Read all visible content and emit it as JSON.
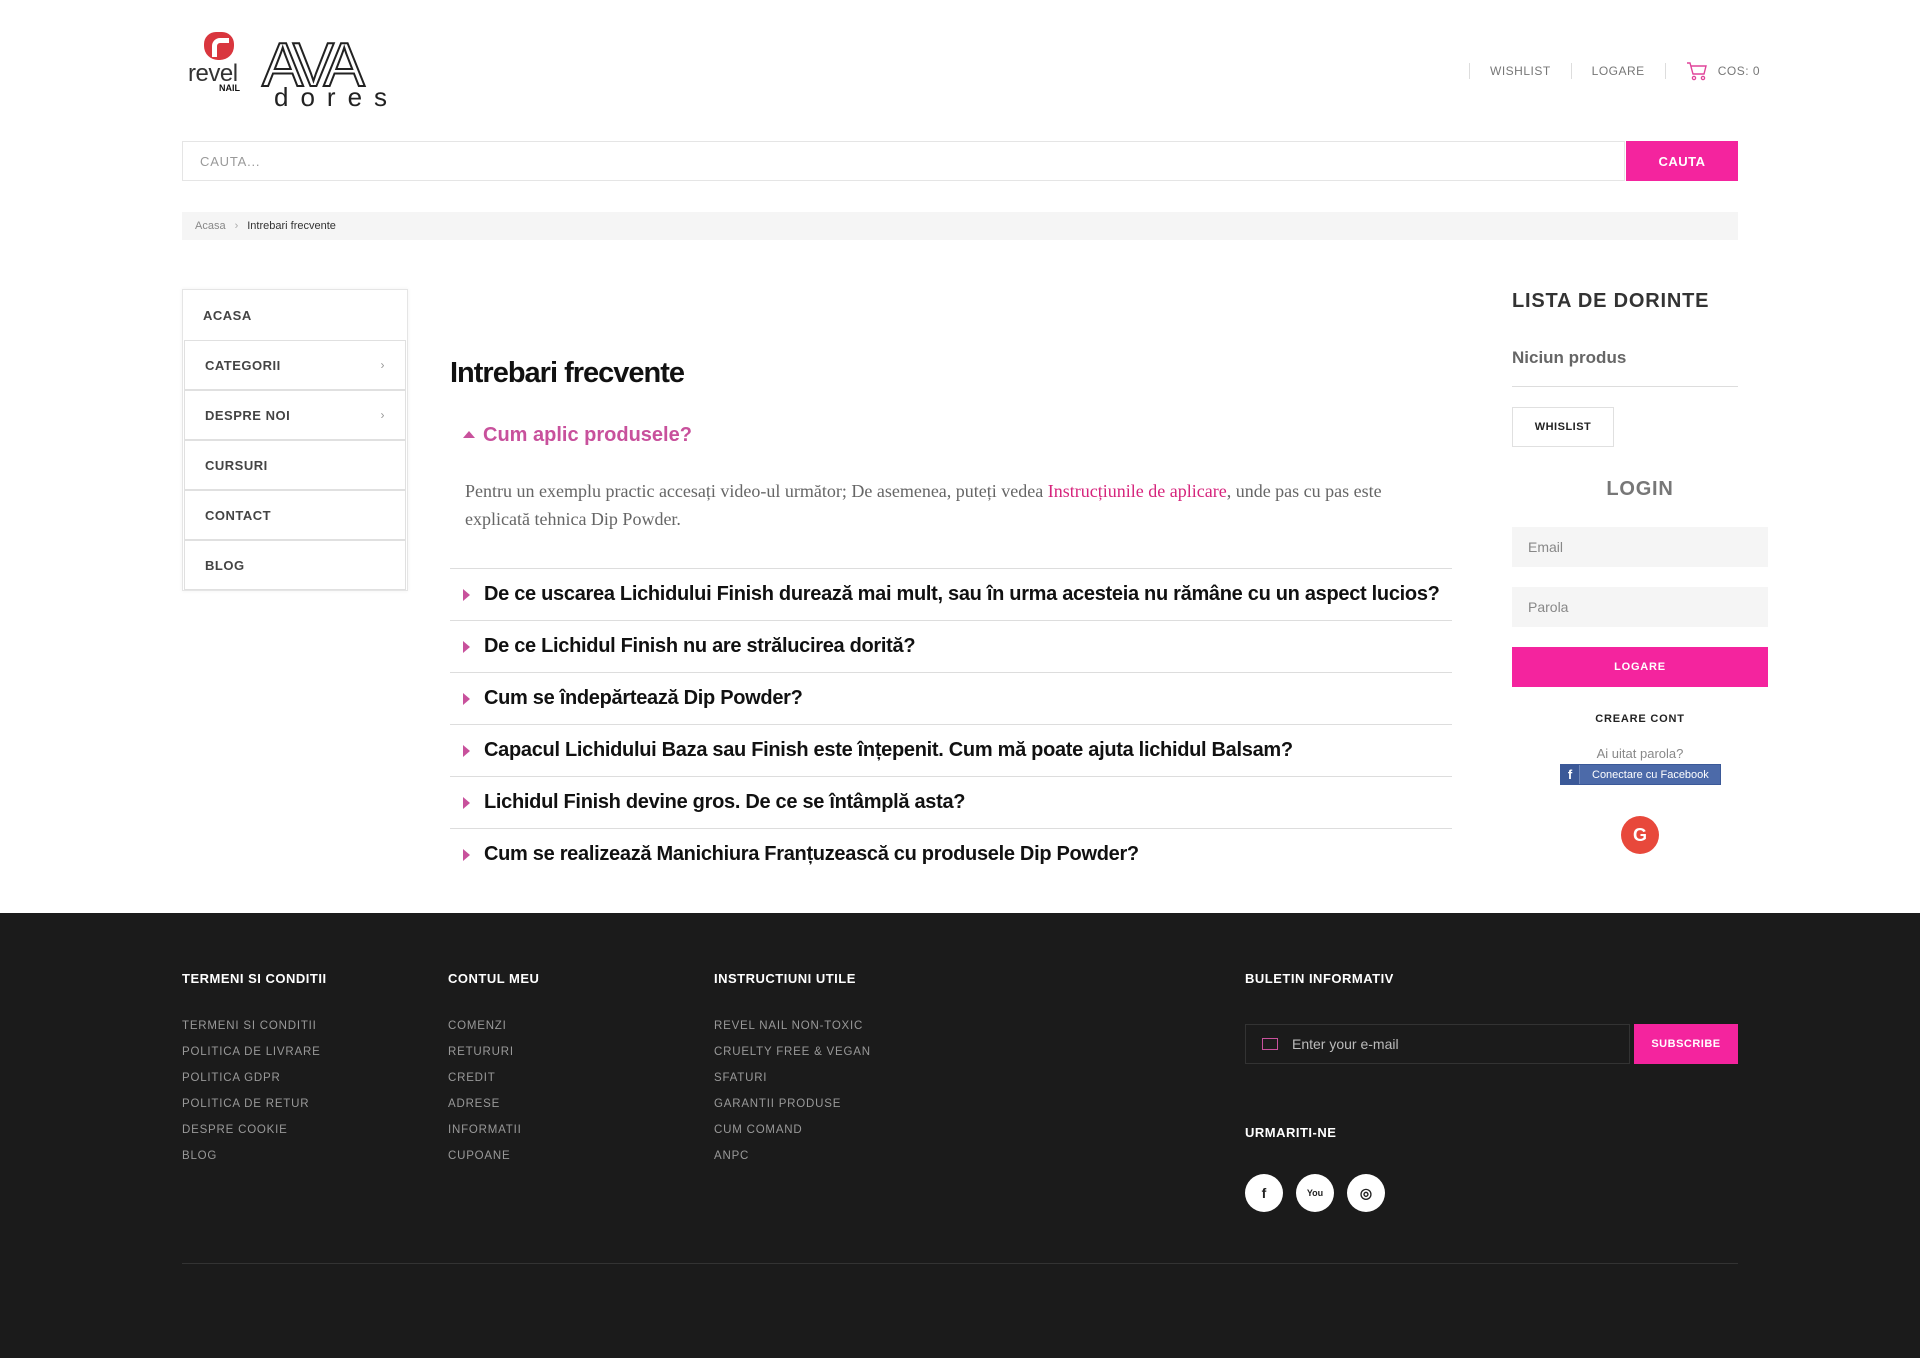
{
  "header": {
    "logo_revel_text": "revel",
    "logo_revel_sub": "NAIL",
    "logo_ava_text": "AVA",
    "logo_ava_sub": "dores",
    "links": {
      "wishlist": "WISHLIST",
      "login": "LOGARE",
      "cart": "COS: 0"
    },
    "search_placeholder": "CAUTA...",
    "search_button": "CAUTA"
  },
  "breadcrumb": {
    "home": "Acasa",
    "separator": "›",
    "current": "Intrebari frecvente"
  },
  "menu": [
    {
      "label": "ACASA",
      "chevron": ""
    },
    {
      "label": "CATEGORII",
      "chevron": "›"
    },
    {
      "label": "DESPRE NOI",
      "chevron": "›"
    },
    {
      "label": "CURSURI",
      "chevron": ""
    },
    {
      "label": "CONTACT",
      "chevron": ""
    },
    {
      "label": "BLOG",
      "chevron": ""
    }
  ],
  "main": {
    "title": "Intrebari frecvente",
    "open_question": "Cum aplic produsele?",
    "answer_before": "Pentru un exemplu practic accesați video-ul următor; De asemenea, puteți vedea ",
    "answer_link": "Instrucțiunile de aplicare",
    "answer_after": ", unde pas cu pas este explicată tehnica Dip Powder.",
    "questions": [
      "De ce uscarea Lichidului Finish durează mai mult, sau în urma acesteia nu rămâne cu un aspect lucios?",
      "De ce Lichidul Finish nu are strălucirea dorită?",
      "Cum se îndepărtează Dip Powder?",
      "Capacul Lichidului Baza sau Finish este înțepenit. Cum mă poate ajuta lichidul Balsam?",
      "Lichidul Finish devine gros. De ce se întâmplă asta?",
      "Cum se realizează Manichiura Franțuzească cu produsele Dip Powder?"
    ]
  },
  "sidebar": {
    "wishlist_title": "LISTA DE DORINTE",
    "wishlist_empty": "Niciun produs",
    "wishlist_button": "WHISLIST",
    "login_title": "LOGIN",
    "email_placeholder": "Email",
    "password_placeholder": "Parola",
    "login_button": "LOGARE",
    "create_account": "CREARE CONT",
    "forgot_password": "Ai uitat parola?",
    "facebook_button": "Conectare cu Facebook",
    "google_button": "G"
  },
  "footer": {
    "col1": {
      "title": "TERMENI SI CONDITII",
      "links": [
        "TERMENI SI CONDITII",
        "POLITICA DE LIVRARE",
        "POLITICA GDPR",
        "POLITICA DE RETUR",
        "DESPRE COOKIE",
        "BLOG"
      ]
    },
    "col2": {
      "title": "CONTUL MEU",
      "links": [
        "COMENZI",
        "RETURURI",
        "CREDIT",
        "ADRESE",
        "INFORMATII",
        "CUPOANE"
      ]
    },
    "col3": {
      "title": "INSTRUCTIUNI UTILE",
      "links": [
        "REVEL NAIL NON-TOXIC",
        "CRUELTY FREE & VEGAN",
        "SFATURI",
        "GARANTII PRODUSE",
        "CUM COMAND",
        "ANPC"
      ]
    },
    "newsletter_title": "BULETIN INFORMATIV",
    "newsletter_placeholder": "Enter your e-mail",
    "subscribe_button": "SUBSCRIBE",
    "follow_title": "URMARITI-NE",
    "social": {
      "facebook": "f",
      "youtube": "You",
      "instagram": "◎"
    }
  },
  "colors": {
    "accent": "#f4249e",
    "question_accent": "#c8519c",
    "footer_bg": "#1b1b1b"
  }
}
